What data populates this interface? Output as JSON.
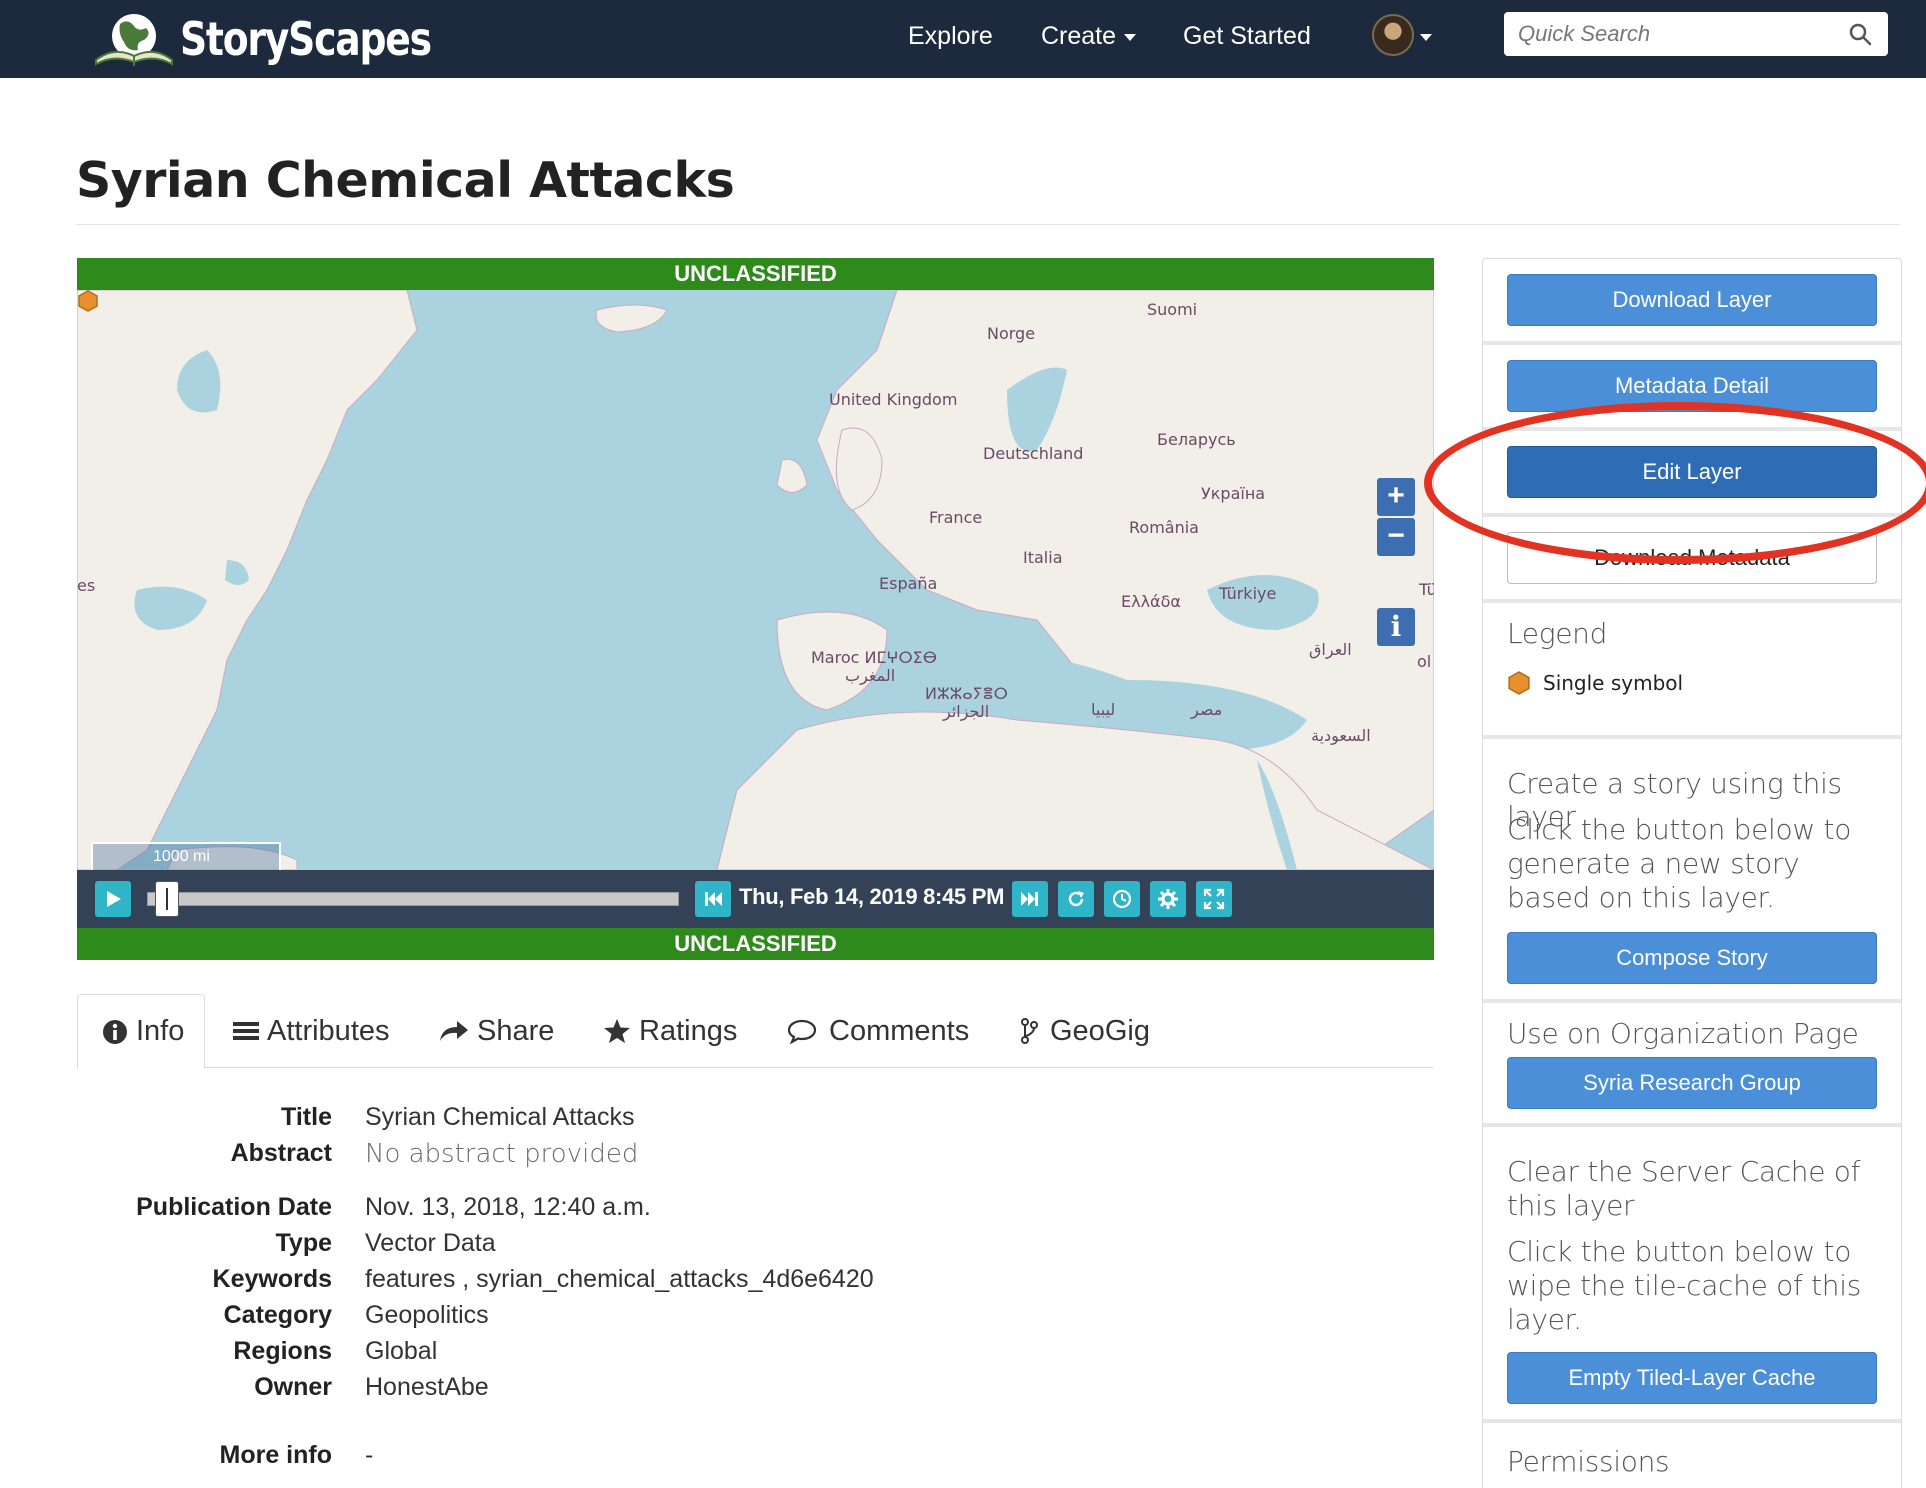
{
  "navbar": {
    "brand": "StoryScapes",
    "links": [
      "Explore",
      "Create",
      "Get Started"
    ],
    "search_placeholder": "Quick Search",
    "icons": [
      "book-globe-logo-icon",
      "search-icon",
      "avatar",
      "caret-down-icon"
    ]
  },
  "page": {
    "title": "Syrian Chemical Attacks"
  },
  "map": {
    "classification": "UNCLASSIFIED",
    "labels": {
      "suomi": "Suomi",
      "norge": "Norge",
      "uk": "United Kingdom",
      "belarus": "Беларусь",
      "deutschland": "Deutschland",
      "ukraine": "Україна",
      "france": "France",
      "romania": "România",
      "italia": "Italia",
      "espana": "España",
      "greece": "Ελλάδα",
      "turkey": "Türkiye",
      "iraq": "العراق",
      "morocco": "Maroc ⵍⵎⵖⵔⵉⴱ",
      "morocco_ar": "المغرب",
      "algeria": "ⵍⵣⵣⴰⵢⴻⵔ",
      "algeria_ar": "الجزائر",
      "libya": "ليبيا",
      "egypt": "مصر",
      "saudi": "السعودية",
      "edge_left": "es",
      "edge_right": "Tü",
      "edge_right2": "ol"
    },
    "scale": "1000 mi",
    "zoom_in": "+",
    "zoom_out": "−",
    "info": "i",
    "marker_color": "#e8902f"
  },
  "playback": {
    "datetime": "Thu, Feb 14, 2019 8:45 PM",
    "progress": 0.02
  },
  "tabs": [
    "Info",
    "Attributes",
    "Share",
    "Ratings",
    "Comments",
    "GeoGig"
  ],
  "info": {
    "title_label": "Title",
    "title": "Syrian Chemical Attacks",
    "abstract_label": "Abstract",
    "abstract": "No abstract provided",
    "pubdate_label": "Publication Date",
    "pubdate": "Nov. 13, 2018, 12:40 a.m.",
    "type_label": "Type",
    "type": "Vector Data",
    "keywords_label": "Keywords",
    "keywords": "features , syrian_chemical_attacks_4d6e6420",
    "category_label": "Category",
    "category": "Geopolitics",
    "regions_label": "Regions",
    "regions": "Global",
    "owner_label": "Owner",
    "owner": "HonestAbe",
    "moreinfo_label": "More info",
    "moreinfo": "-"
  },
  "sidebar": {
    "download_layer": "Download Layer",
    "metadata_detail": "Metadata Detail",
    "edit_layer": "Edit Layer",
    "download_metadata": "Download Metadata",
    "legend_title": "Legend",
    "legend_item": "Single symbol",
    "story_title": "Create a story using this layer",
    "story_text": "Click the button below to generate a new story based on this layer.",
    "compose_story": "Compose Story",
    "org_title": "Use on Organization Page",
    "org_button": "Syria Research Group",
    "cache_title": "Clear the Server Cache of this layer",
    "cache_text": "Click the button below to wipe the tile-cache of this layer.",
    "cache_button": "Empty Tiled-Layer Cache",
    "permissions": "Permissions"
  },
  "colors": {
    "navbar": "#1d2a3d",
    "classification": "#2e8a1a",
    "primary": "#4a8fd7",
    "playback": "#334257",
    "play_buttons": "#2fb5c7",
    "annotation": "#e23222"
  }
}
